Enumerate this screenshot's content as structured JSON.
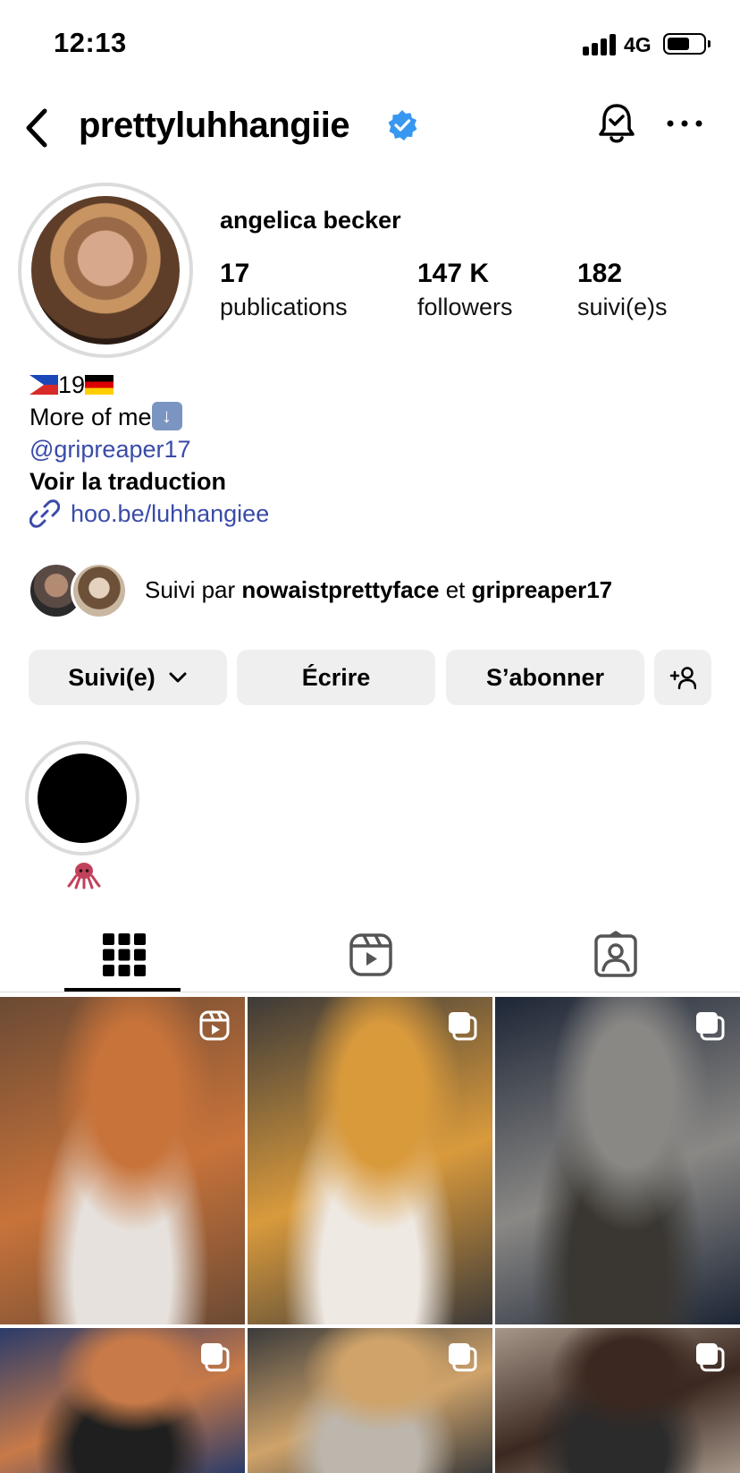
{
  "status_bar": {
    "time": "12:13",
    "network": "4G"
  },
  "header": {
    "username": "prettyluhhangiie"
  },
  "profile": {
    "full_name": "angelica becker",
    "stats": [
      {
        "value": "17",
        "label": "publications"
      },
      {
        "value": "147 K",
        "label": "followers"
      },
      {
        "value": "182",
        "label": "suivi(e)s"
      }
    ]
  },
  "bio": {
    "age": "19",
    "line2": "More of me",
    "mention": "@gripreaper17",
    "translate": "Voir la traduction",
    "link": "hoo.be/luhhangiee"
  },
  "followed_by": {
    "prefix": "Suivi par ",
    "user1": "nowaistprettyface",
    "joiner": " et ",
    "user2": "gripreaper17"
  },
  "buttons": {
    "following": "Suivi(e)",
    "message": "Écrire",
    "subscribe": "S’abonner"
  },
  "highlights": [
    {
      "label": "octopus emoji"
    }
  ],
  "tabs": [
    {
      "icon": "grid-icon"
    },
    {
      "icon": "reels-icon"
    },
    {
      "icon": "tagged-icon"
    }
  ],
  "posts": [
    {
      "type": "reel",
      "colors": [
        "#6b4a34",
        "#c8733a",
        "#e6e1dc"
      ]
    },
    {
      "type": "carousel",
      "colors": [
        "#3d3a38",
        "#d99a3c",
        "#efe9e3"
      ]
    },
    {
      "type": "carousel",
      "colors": [
        "#1d2636",
        "#8a8885",
        "#3a3732"
      ]
    },
    {
      "type": "carousel",
      "colors": [
        "#2a3b6a",
        "#c87a48",
        "#1f1f1f"
      ]
    },
    {
      "type": "carousel",
      "colors": [
        "#3b3b3b",
        "#cfa36a",
        "#bcb6ad"
      ]
    },
    {
      "type": "carousel",
      "colors": [
        "#a6978a",
        "#3b2820",
        "#2b2b2b"
      ]
    }
  ]
}
